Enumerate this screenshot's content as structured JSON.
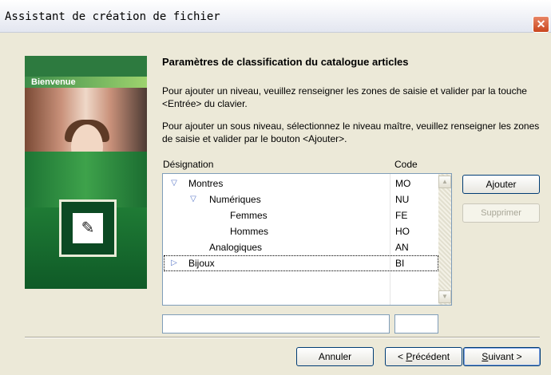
{
  "window": {
    "title": "Assistant de création de fichier",
    "close_glyph": "✕"
  },
  "sidebar": {
    "welcome": "Bienvenue",
    "icon": "document-icon",
    "icon_glyph": "✎"
  },
  "main": {
    "heading": "Paramètres de classification du catalogue articles",
    "paragraph1": "Pour ajouter un niveau, veuillez renseigner les zones de saisie et valider par la touche <Entrée> du clavier.",
    "paragraph2": "Pour ajouter un sous niveau, sélectionnez le niveau maître, veuillez renseigner les zones de saisie et valider par le bouton <Ajouter>.",
    "columns": {
      "designation": "Désignation",
      "code": "Code"
    },
    "rows": [
      {
        "label": "Montres",
        "code": "MO",
        "marker": "▽",
        "expanded": true
      },
      {
        "label": "Numériques",
        "code": "NU",
        "marker": "▽",
        "expanded": true
      },
      {
        "label": "Femmes",
        "code": "FE",
        "marker": ""
      },
      {
        "label": "Hommes",
        "code": "HO",
        "marker": ""
      },
      {
        "label": "Analogiques",
        "code": "AN",
        "marker": ""
      },
      {
        "label": "Bijoux",
        "code": "BI",
        "marker": "▷",
        "expanded": false,
        "selected": true
      }
    ],
    "scroll_up": "▲",
    "scroll_down": "▼",
    "inputs": {
      "designation_value": "",
      "code_value": ""
    }
  },
  "buttons": {
    "add": "Ajouter",
    "delete": "Supprimer",
    "cancel": "Annuler",
    "prev_prefix": "< ",
    "prev_key": "P",
    "prev_rest": "récédent",
    "next_key": "S",
    "next_rest": "uivant >"
  },
  "colors": {
    "accent": "#003c74",
    "panel_green": "#2c8f3f",
    "close_red": "#c9461d"
  }
}
